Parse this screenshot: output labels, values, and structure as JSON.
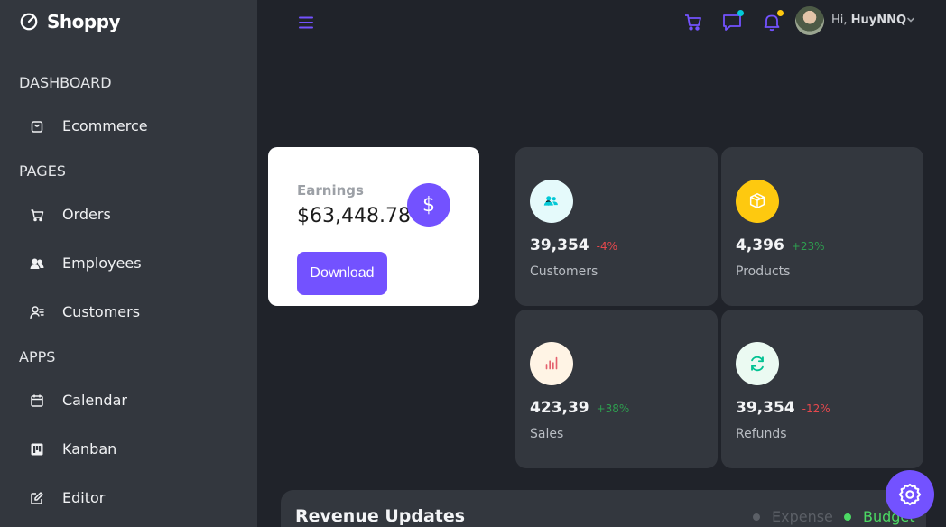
{
  "app": {
    "title": "Shoppy"
  },
  "sidebar": {
    "sections": [
      {
        "title": "DASHBOARD",
        "items": [
          {
            "label": "Ecommerce",
            "icon": "shopping-bag-icon"
          }
        ]
      },
      {
        "title": "PAGES",
        "items": [
          {
            "label": "Orders",
            "icon": "cart-icon"
          },
          {
            "label": "Employees",
            "icon": "employees-icon"
          },
          {
            "label": "Customers",
            "icon": "customers-icon"
          }
        ]
      },
      {
        "title": "APPS",
        "items": [
          {
            "label": "Calendar",
            "icon": "calendar-icon"
          },
          {
            "label": "Kanban",
            "icon": "kanban-icon"
          },
          {
            "label": "Editor",
            "icon": "edit-icon"
          }
        ]
      }
    ]
  },
  "header": {
    "greeting": "Hi,",
    "user_name": "HuyNNQ",
    "icons": [
      "menu-icon",
      "cart-icon",
      "chat-icon",
      "notification-bell-icon",
      "chevron-down-icon"
    ]
  },
  "earnings": {
    "label": "Earnings",
    "value": "$63,448.78",
    "icon_glyph": "$",
    "button_label": "Download"
  },
  "stats": [
    {
      "id": "customers",
      "value": "39,354",
      "change": "-4%",
      "change_color": "#e5484d",
      "label": "Customers",
      "icon": "customers-icon",
      "icon_color": "#03c9d7",
      "icon_bg": "#e5fafb"
    },
    {
      "id": "products",
      "value": "4,396",
      "change": "+23%",
      "change_color": "#2e9e4f",
      "label": "Products",
      "icon": "box-icon",
      "icon_color": "#ffffff",
      "icon_bg": "#fec90f"
    },
    {
      "id": "sales",
      "value": "423,39",
      "change": "+38%",
      "change_color": "#2e9e4f",
      "label": "Sales",
      "icon": "bar-chart-icon",
      "icon_color": "#e4606d",
      "icon_bg": "#fff4e5"
    },
    {
      "id": "refunds",
      "value": "39,354",
      "change": "-12%",
      "change_color": "#e5484d",
      "label": "Refunds",
      "icon": "refresh-icon",
      "icon_color": "#00c292",
      "icon_bg": "#ebfaf2"
    }
  ],
  "revenue": {
    "title": "Revenue Updates",
    "legend": [
      {
        "label": "Expense",
        "color": "#5b5f66"
      },
      {
        "label": "Budget",
        "color": "#4cd964"
      }
    ]
  },
  "colors": {
    "accent": "#7352ff",
    "sidebar": "#33373e",
    "background": "#20232a",
    "notification_dot_chat": "#03c9d7",
    "notification_dot_bell": "#fec90f"
  }
}
